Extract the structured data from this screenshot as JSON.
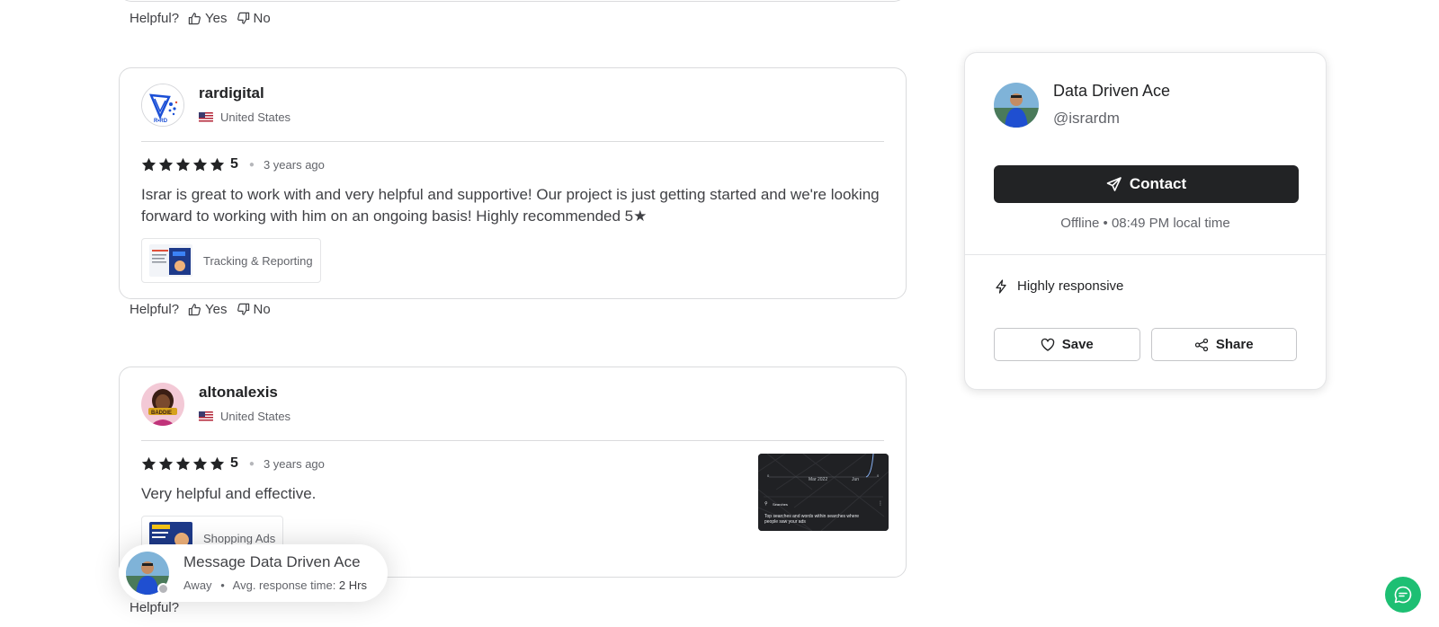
{
  "helpful_bar": {
    "label": "Helpful?",
    "yes": "Yes",
    "no": "No"
  },
  "reviews": [
    {
      "username": "rardigital",
      "country": "United States",
      "rating": "5",
      "time": "3 years ago",
      "text": "Israr is great to work with and very helpful and supportive! Our project is just getting started and we're looking forward to working with him on an ongoing basis! Highly recommended 5★",
      "tag": "Tracking & Reporting",
      "avatar_icon": "rd-logo-icon"
    },
    {
      "username": "altonalexis",
      "country": "United States",
      "rating": "5",
      "time": "3 years ago",
      "text": "Very helpful and effective.",
      "tag": "Shopping Ads",
      "avatar_icon": "character-avatar-icon",
      "attachment": {
        "axis_left": "0",
        "axis_mid": "Mar 2022",
        "axis_right_label": "Jun",
        "axis_right": "0",
        "search_label": "Searches",
        "caption": "Top searches and words within searches where people saw your ads"
      }
    }
  ],
  "seller": {
    "name": "Data Driven Ace",
    "handle": "@isrardm",
    "contact_label": "Contact",
    "status": "Offline • 08:49 PM local time",
    "responsive": "Highly responsive",
    "save_label": "Save",
    "share_label": "Share"
  },
  "message_pill": {
    "title": "Message Data Driven Ace",
    "status": "Away",
    "response_prefix": "Avg. response time: ",
    "response_time": "2 Hrs"
  },
  "colors": {
    "accent": "#1dbf73",
    "dark_button": "#222325",
    "border": "#dadbdd",
    "star": "#222325"
  }
}
